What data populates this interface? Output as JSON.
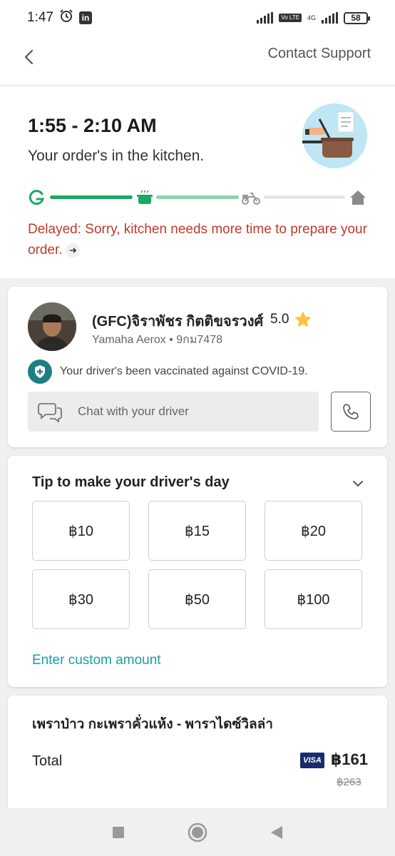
{
  "status_bar": {
    "time": "1:47",
    "network": "4G",
    "volte": "Vo LTE",
    "battery": "58"
  },
  "header": {
    "contact_support": "Contact Support"
  },
  "order_status": {
    "eta": "1:55 - 2:10 AM",
    "status": "Your order's in the kitchen.",
    "delay_message": "Delayed: Sorry, kitchen needs more time to prepare your order.",
    "progress": {
      "segment_1": 1.0,
      "segment_2": 1.0,
      "segment_3": 0.0
    }
  },
  "driver": {
    "name": "(GFC)จิราพัชร กิตติขจรวงศ์",
    "rating": "5.0",
    "vehicle": "Yamaha Aerox • 9กม7478",
    "vaccination": "Your driver's been vaccinated against COVID-19.",
    "chat_placeholder": "Chat with your driver"
  },
  "tip": {
    "title": "Tip to make your driver's day",
    "options": [
      "฿10",
      "฿15",
      "฿20",
      "฿30",
      "฿50",
      "฿100"
    ],
    "custom_amount": "Enter custom amount"
  },
  "summary": {
    "restaurant": "เพราป่าว กะเพราคั่วแห้ง - พาราไดซ์วิลล่า",
    "total_label": "Total",
    "payment_method": "VISA",
    "total_price": "฿161",
    "original_price": "฿263"
  },
  "colors": {
    "brand_green": "#1aa863",
    "delay_red": "#c0392b",
    "link_teal": "#1a9da5",
    "vacc_teal": "#1e7f83"
  }
}
